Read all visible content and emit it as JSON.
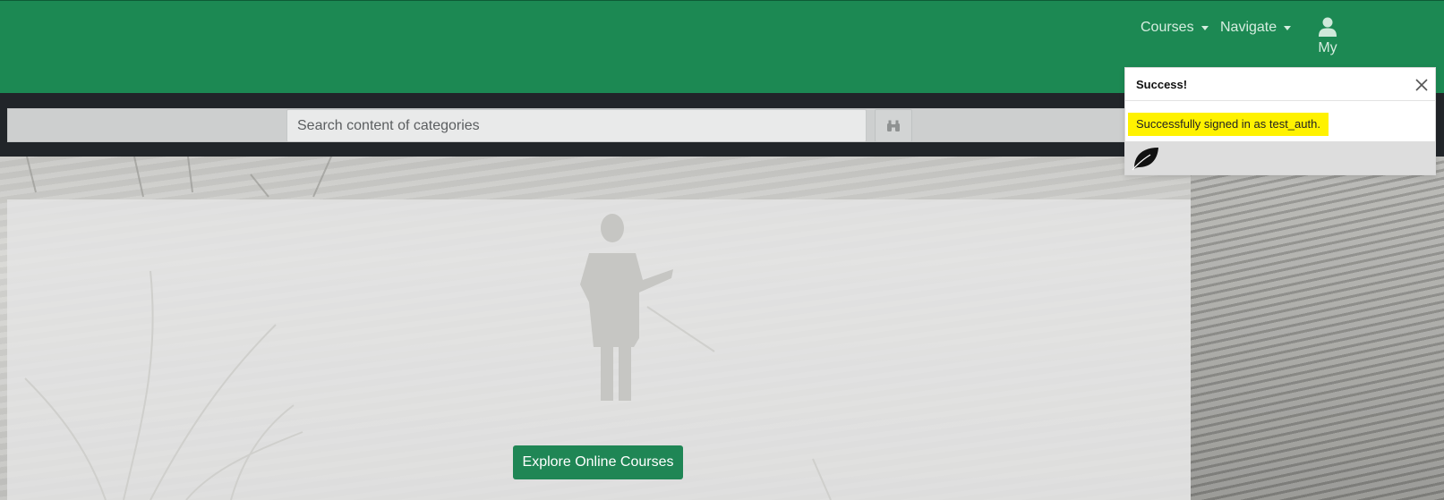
{
  "nav": {
    "courses_label": "Courses",
    "navigate_label": "Navigate",
    "user_label": "My"
  },
  "search": {
    "placeholder": "Search content of categories"
  },
  "hero": {
    "button_label": "Explore Online Courses"
  },
  "toast": {
    "title": "Success!",
    "message": "Successfully signed in as test_auth.",
    "highlight_color": "#fff200"
  },
  "colors": {
    "brand_green": "#1c8953",
    "dark_bar": "#212529",
    "button_green": "#1f8655"
  },
  "icons": {
    "user": "user-icon",
    "search": "binoculars-icon",
    "close": "close-icon",
    "leaf": "leaf-icon"
  }
}
